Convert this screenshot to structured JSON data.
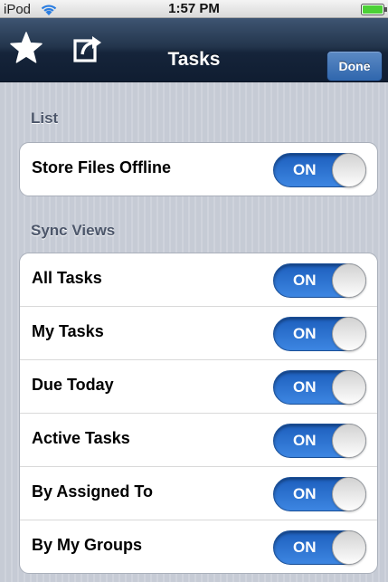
{
  "status_bar": {
    "carrier": "iPod",
    "time": "1:57 PM",
    "icons": [
      "wifi-icon",
      "battery-icon"
    ]
  },
  "nav_bar": {
    "title": "Tasks",
    "done_label": "Done",
    "icons": [
      "star-icon",
      "share-icon"
    ]
  },
  "sections": {
    "list": {
      "header": "List",
      "items": [
        {
          "label": "Store Files Offline",
          "state": "ON"
        }
      ]
    },
    "sync_views": {
      "header": "Sync Views",
      "items": [
        {
          "label": "All Tasks",
          "state": "ON"
        },
        {
          "label": "My Tasks",
          "state": "ON"
        },
        {
          "label": "Due Today",
          "state": "ON"
        },
        {
          "label": "Active Tasks",
          "state": "ON"
        },
        {
          "label": "By Assigned To",
          "state": "ON"
        },
        {
          "label": "By My Groups",
          "state": "ON"
        }
      ]
    }
  },
  "colors": {
    "toggle_on": "#2b74d6",
    "nav_bar": "#1c2c44",
    "done_button": "#3f73b8",
    "section_header": "#4c566a"
  }
}
